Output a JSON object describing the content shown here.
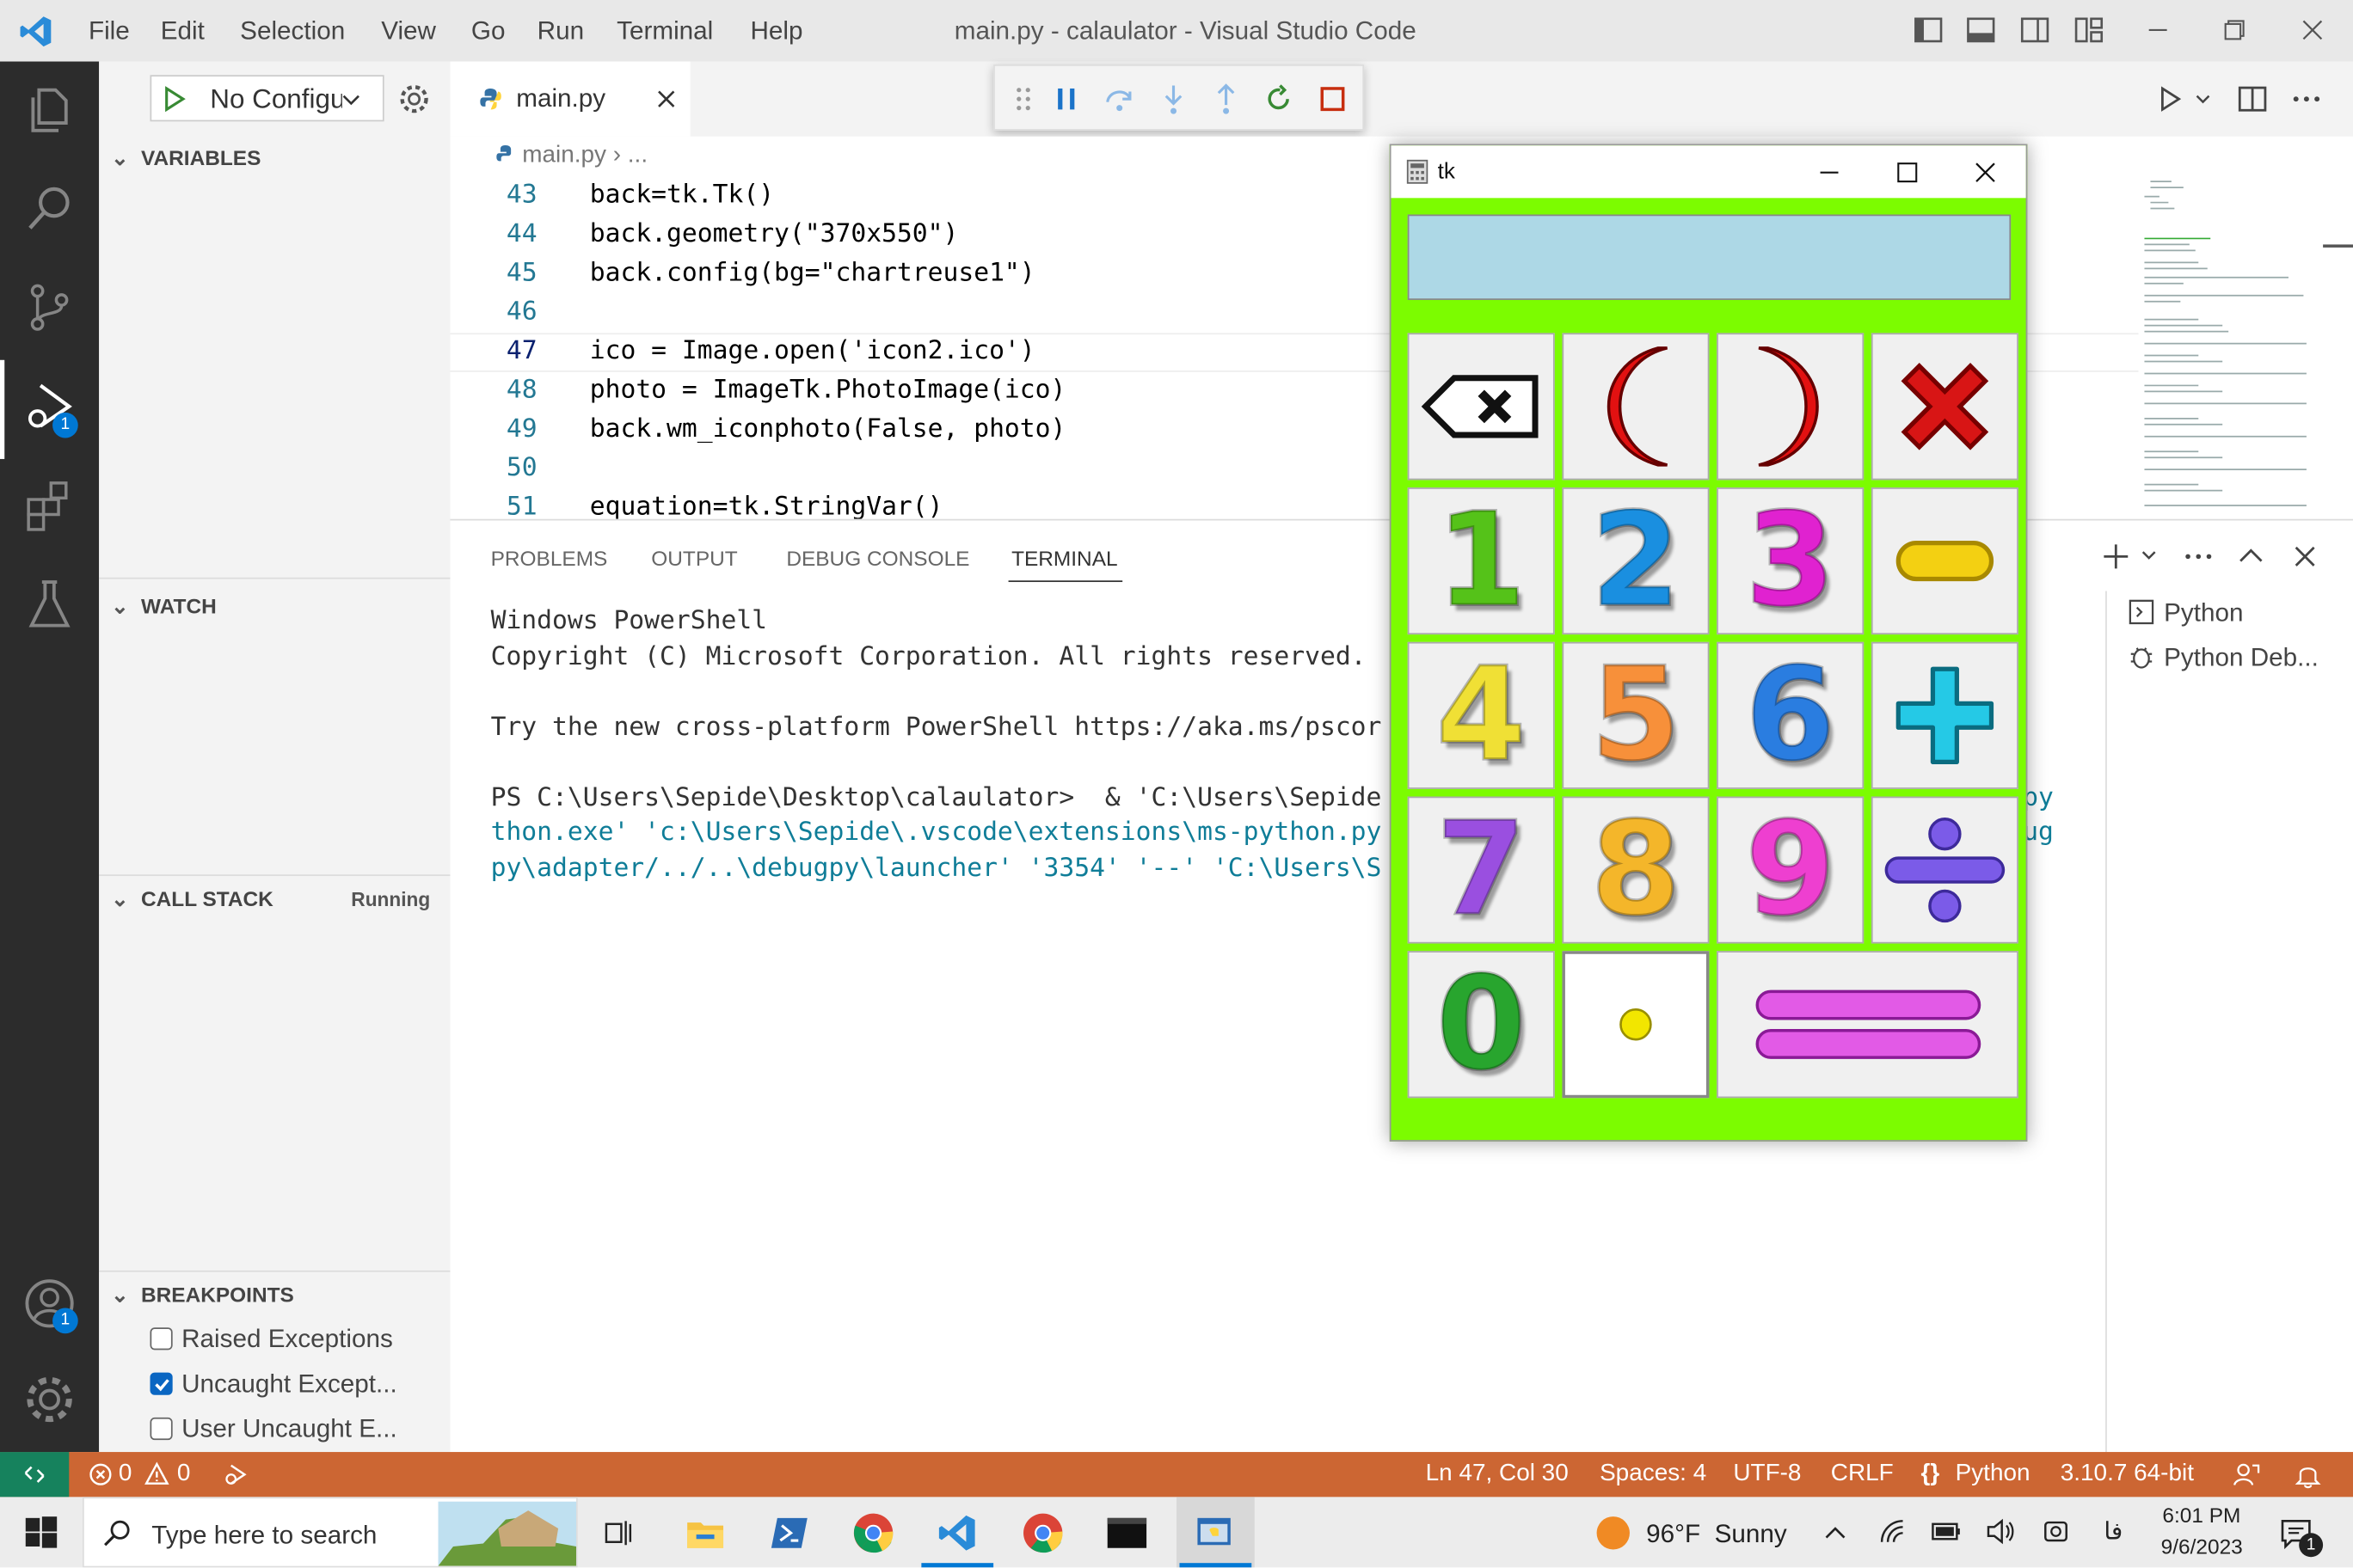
{
  "window": {
    "title": "main.py - calaulator - Visual Studio Code",
    "menu": [
      "File",
      "Edit",
      "Selection",
      "View",
      "Go",
      "Run",
      "Terminal",
      "Help"
    ]
  },
  "debug_toolbar": {
    "icons": [
      "drag-handle-icon",
      "pause-icon",
      "step-over-icon",
      "step-into-icon",
      "step-out-icon",
      "restart-icon",
      "stop-icon"
    ]
  },
  "activity": {
    "debug_badge": "1",
    "account_badge": "1"
  },
  "sidebar": {
    "run_config": "No Configu",
    "variables": "VARIABLES",
    "watch": "WATCH",
    "call_stack": "CALL STACK",
    "call_stack_status": "Running",
    "breakpoints": "BREAKPOINTS",
    "breakpoint_items": [
      {
        "label": "Raised Exceptions",
        "checked": false
      },
      {
        "label": "Uncaught Except...",
        "checked": true
      },
      {
        "label": "User Uncaught E...",
        "checked": false
      }
    ]
  },
  "editor": {
    "tab": "main.py",
    "breadcrumb_file": "main.py",
    "breadcrumb_rest": "...",
    "lines": [
      {
        "n": "43",
        "code": "back=tk.Tk()"
      },
      {
        "n": "44",
        "code": "back.geometry(\"370x550\")"
      },
      {
        "n": "45",
        "code": "back.config(bg=\"chartreuse1\")"
      },
      {
        "n": "46",
        "code": ""
      },
      {
        "n": "47",
        "code": "ico = Image.open('icon2.ico')"
      },
      {
        "n": "48",
        "code": "photo = ImageTk.PhotoImage(ico)"
      },
      {
        "n": "49",
        "code": "back.wm_iconphoto(False, photo)"
      },
      {
        "n": "50",
        "code": ""
      },
      {
        "n": "51",
        "code": "equation=tk.StringVar()"
      }
    ]
  },
  "panel": {
    "tabs": [
      "PROBLEMS",
      "OUTPUT",
      "DEBUG CONSOLE",
      "TERMINAL"
    ],
    "active_tab": "TERMINAL",
    "terminal_lines": [
      "Windows PowerShell",
      "Copyright (C) Microsoft Corporation. All rights reserved.",
      "",
      "Try the new cross-platform PowerShell https://aka.ms/pscor",
      "",
      "PS C:\\Users\\Sepide\\Desktop\\calaulator>  & 'C:\\Users\\Sepide",
      "thon.exe' 'c:\\Users\\Sepide\\.vscode\\extensions\\ms-python.py",
      "py\\adapter/../..\\debugpy\\launcher' '3354' '--' 'C:\\Users\\S"
    ],
    "terminal_overflow": [
      "py",
      "ug"
    ],
    "terminals": [
      "Python",
      "Python Deb..."
    ]
  },
  "status": {
    "errors": "0",
    "warnings": "0",
    "position": "Ln 47, Col 30",
    "spaces": "Spaces: 4",
    "encoding": "UTF-8",
    "eol": "CRLF",
    "language": "Python",
    "interpreter": "3.10.7 64-bit"
  },
  "taskbar": {
    "search_placeholder": "Type here to search",
    "weather": "96°F  Sunny",
    "time": "6:01 PM",
    "date": "9/6/2023",
    "lang": "فا",
    "notif_badge": "1"
  },
  "tk": {
    "title": "tk",
    "keys": [
      {
        "label": "⌫",
        "name": "backspace-key"
      },
      {
        "label": "(",
        "name": "open-paren-key"
      },
      {
        "label": ")",
        "name": "close-paren-key"
      },
      {
        "label": "✖",
        "name": "multiply-key"
      },
      {
        "label": "1",
        "name": "digit-1-key"
      },
      {
        "label": "2",
        "name": "digit-2-key"
      },
      {
        "label": "3",
        "name": "digit-3-key"
      },
      {
        "label": "−",
        "name": "minus-key"
      },
      {
        "label": "4",
        "name": "digit-4-key"
      },
      {
        "label": "5",
        "name": "digit-5-key"
      },
      {
        "label": "6",
        "name": "digit-6-key"
      },
      {
        "label": "+",
        "name": "plus-key"
      },
      {
        "label": "7",
        "name": "digit-7-key"
      },
      {
        "label": "8",
        "name": "digit-8-key"
      },
      {
        "label": "9",
        "name": "digit-9-key"
      },
      {
        "label": "÷",
        "name": "divide-key"
      },
      {
        "label": "0",
        "name": "digit-0-key"
      },
      {
        "label": "•",
        "name": "decimal-key"
      },
      {
        "label": "=",
        "name": "equals-key"
      }
    ],
    "colors": {
      "bg": "#7cfc00",
      "display": "#add8e6"
    }
  }
}
